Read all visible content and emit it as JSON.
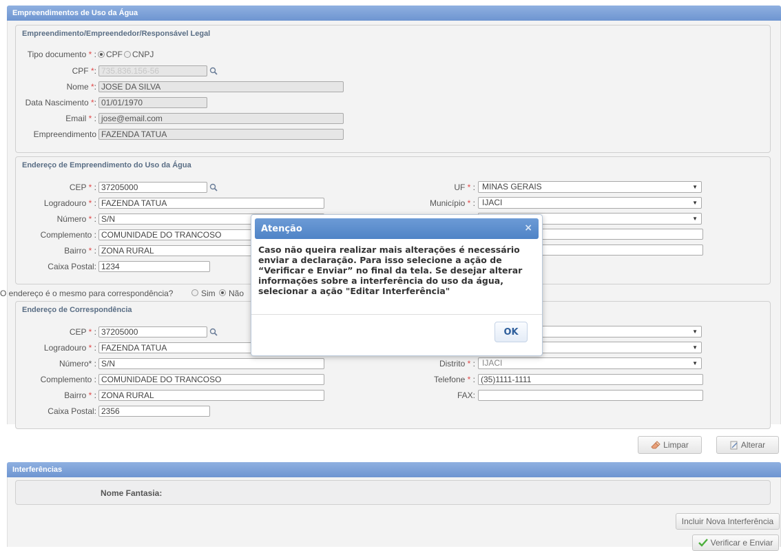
{
  "section1": {
    "title": "Empreendimentos de Uso da Água",
    "group_title": "Empreendimento/Empreendedor/Responsável Legal",
    "tipo_documento_label": "Tipo documento",
    "cpf_option": "CPF",
    "cnpj_option": "CNPJ",
    "cpf_label": "CPF",
    "cpf_value": "735.836.156-56",
    "nome_label": "Nome",
    "nome_value": "JOSE DA SILVA",
    "nascimento_label": "Data Nascimento",
    "nascimento_value": "01/01/1970",
    "email_label": "Email",
    "email_value": "jose@email.com",
    "empreendimento_label": "Empreendimento",
    "empreendimento_value": "FAZENDA TATUA"
  },
  "endereco": {
    "group_title": "Endereço de Empreendimento do Uso da Água",
    "cep_label": "CEP",
    "cep_value": "37205000",
    "logradouro_label": "Logradouro",
    "logradouro_value": "FAZENDA TATUA",
    "numero_label": "Número",
    "numero_value": "S/N",
    "complemento_label": "Complemento",
    "complemento_value": "COMUNIDADE DO TRANCOSO",
    "bairro_label": "Bairro",
    "bairro_value": "ZONA RURAL",
    "caixa_label": "Caixa Postal:",
    "caixa_value": "1234",
    "uf_label": "UF",
    "uf_value": "MINAS GERAIS",
    "municipio_label": "Município",
    "municipio_value": "IJACI"
  },
  "correspondencia_question": {
    "text": "O endereço é o mesmo para correspondência?",
    "sim": "Sim",
    "nao": "Não"
  },
  "correspondencia": {
    "group_title": "Endereço de Correspondência",
    "cep_label": "CEP",
    "cep_value": "37205000",
    "logradouro_label": "Logradouro",
    "logradouro_value": "FAZENDA TATUA",
    "numero_label": "Número*",
    "numero_value": "S/N",
    "complemento_label": "Complemento",
    "complemento_value": "COMUNIDADE DO TRANCOSO",
    "bairro_label": "Bairro",
    "bairro_value": "ZONA RURAL",
    "caixa_label": "Caixa Postal:",
    "caixa_value": "2356",
    "distrito_label": "Distrito",
    "distrito_value": "IJACI",
    "telefone_label": "Telefone",
    "telefone_value": "(35)1111-1111",
    "fax_label": "FAX:",
    "fax_value": ""
  },
  "actions": {
    "limpar": "Limpar",
    "alterar": "Alterar"
  },
  "interferencias": {
    "title": "Interferências",
    "nome_fantasia": "Nome Fantasia:",
    "incluir": "Incluir Nova Interferência",
    "verificar": "Verificar e Enviar"
  },
  "dialog": {
    "title": "Atenção",
    "close": "×",
    "message": "Caso não queira realizar mais alterações é necessário enviar a declaração. Para isso selecione a ação de “Verificar e Enviar” no final da tela. Se desejar alterar informações sobre a interferência do uso da água, selecionar a ação \"Editar Interferência\"",
    "ok": "OK"
  },
  "colors": {
    "header": "#7ea3da",
    "dialog_header": "#5e8fce",
    "required": "#e04848"
  }
}
